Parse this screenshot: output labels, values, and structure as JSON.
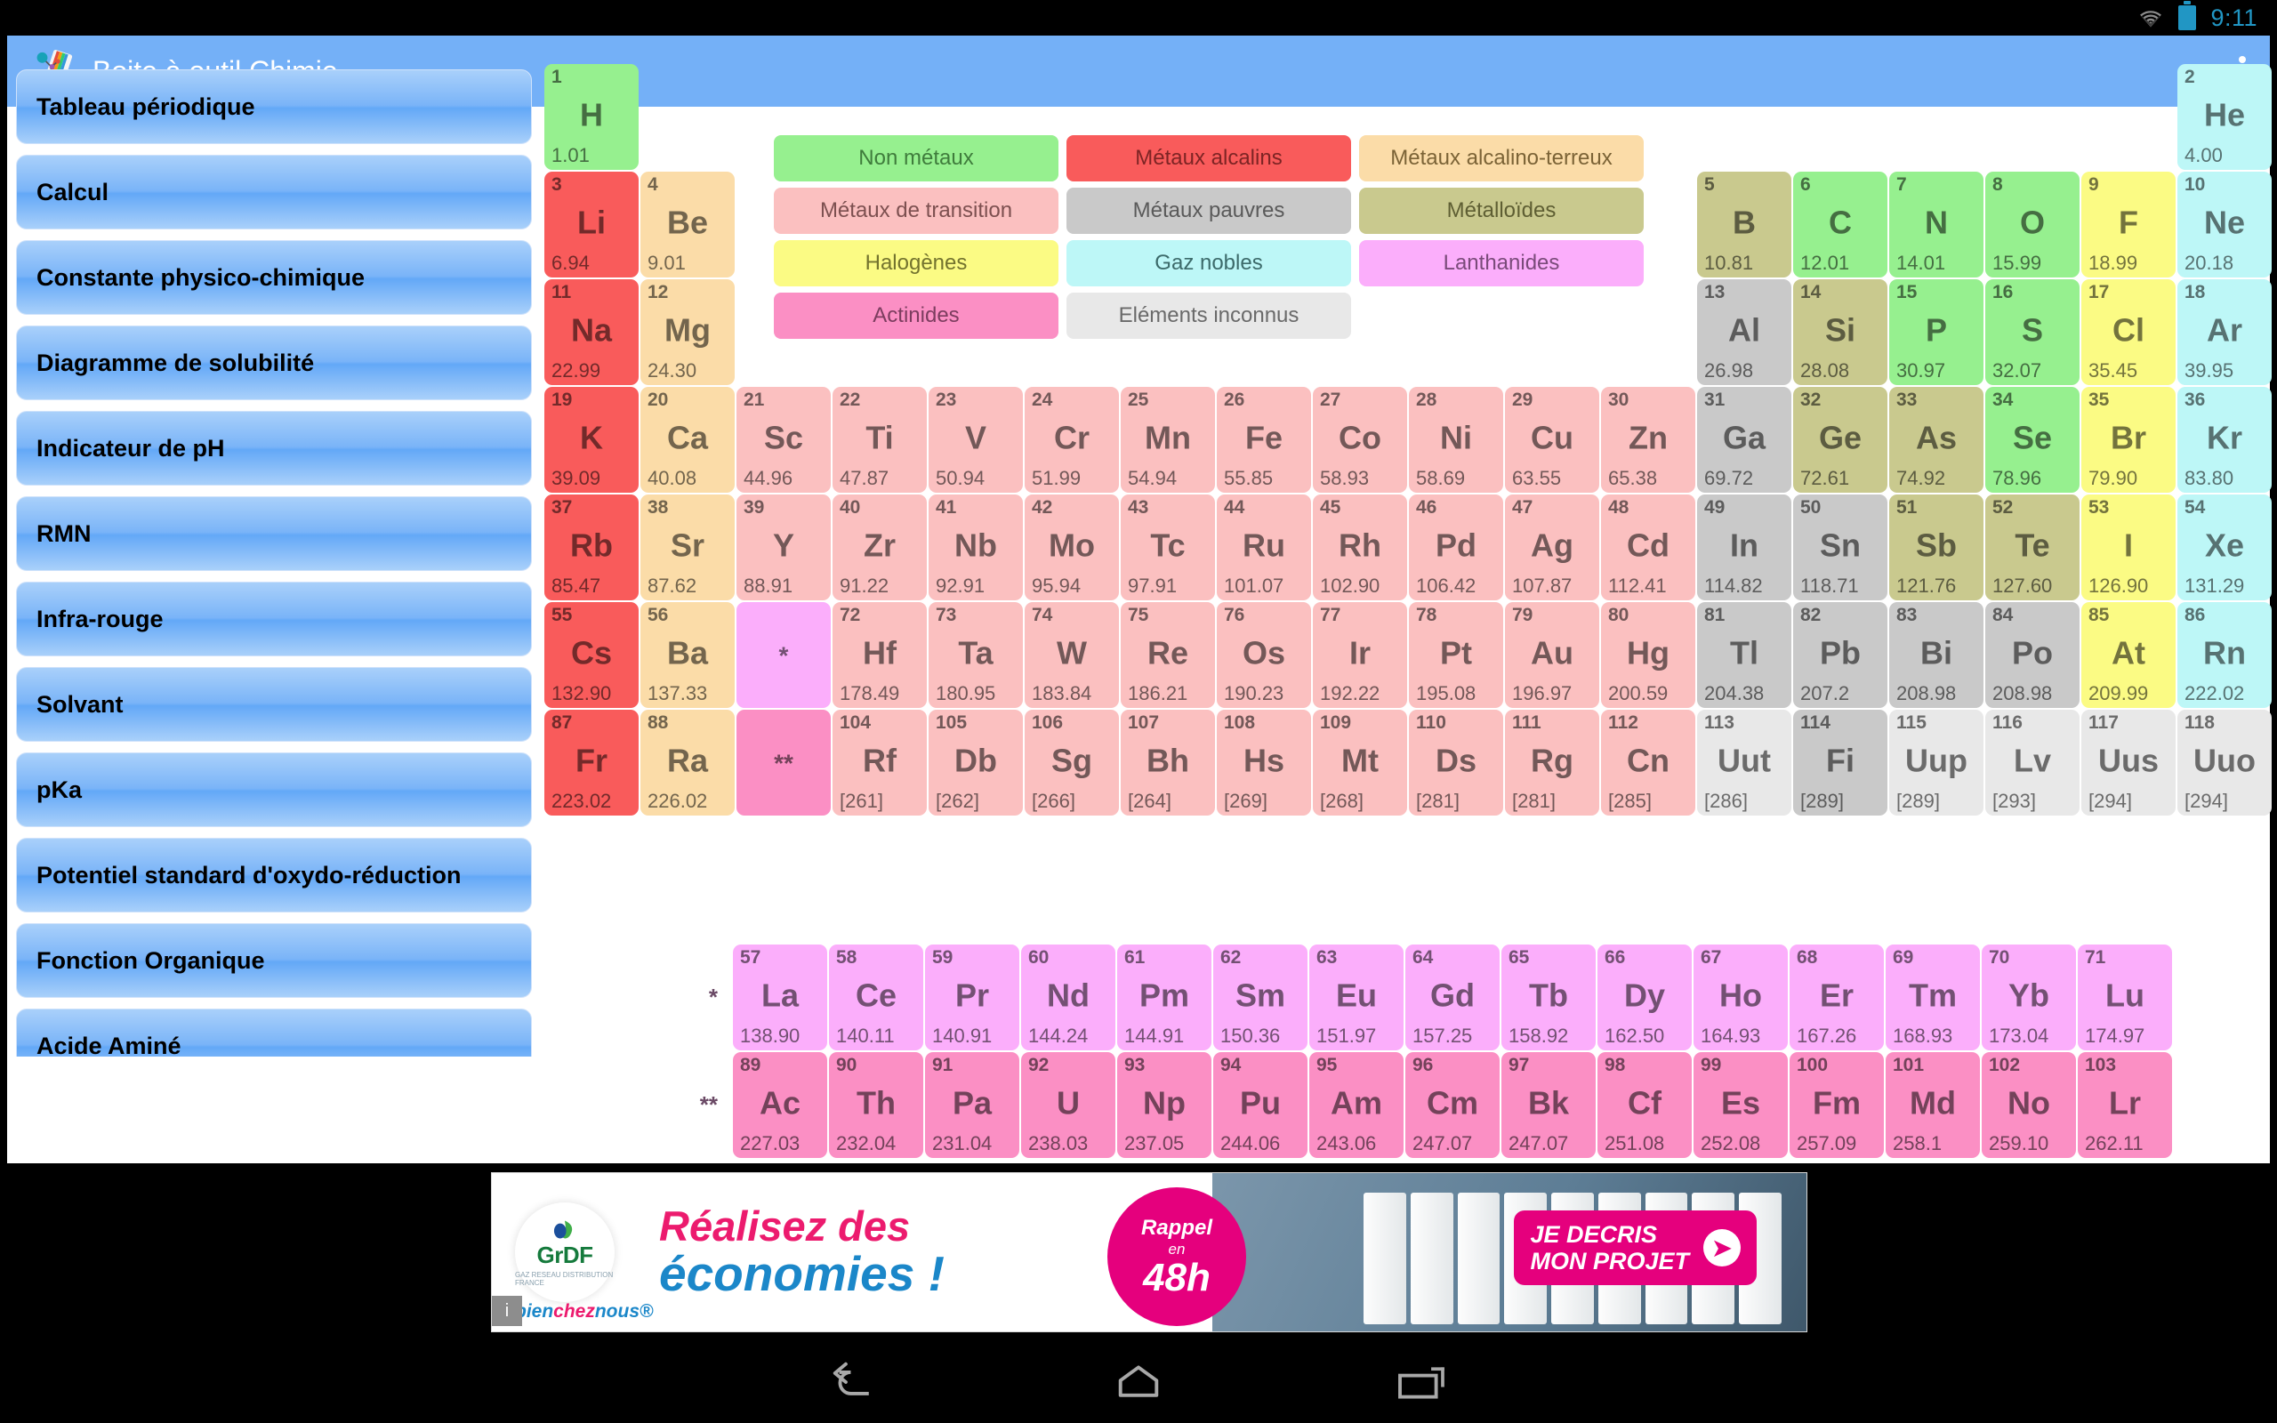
{
  "status_bar": {
    "time": "9:11",
    "wifi_icon": "wifi-icon",
    "battery_icon": "battery-icon"
  },
  "app_bar": {
    "title": "Boite à outil Chimie",
    "logo_icon": "chemistry-toolbox-icon",
    "overflow_icon": "overflow-menu-icon"
  },
  "sidebar": {
    "items": [
      {
        "label": "Tableau périodique"
      },
      {
        "label": "Calcul"
      },
      {
        "label": "Constante physico-chimique"
      },
      {
        "label": "Diagramme de solubilité"
      },
      {
        "label": "Indicateur de pH"
      },
      {
        "label": "RMN"
      },
      {
        "label": "Infra-rouge"
      },
      {
        "label": "Solvant"
      },
      {
        "label": "pKa"
      },
      {
        "label": "Potentiel standard d'oxydo-réduction"
      },
      {
        "label": "Fonction Organique"
      },
      {
        "label": "Acide Aminé"
      }
    ]
  },
  "legend": {
    "items": [
      {
        "label": "Non métaux",
        "color": "#96f08f",
        "text": "#3f7c3c"
      },
      {
        "label": "Métaux alcalins",
        "color": "#f95b5b",
        "text": "#7d2424"
      },
      {
        "label": "Métaux alcalino-terreux",
        "color": "#fbdca8",
        "text": "#7b6336"
      },
      {
        "label": "Métaux de transition",
        "color": "#fbc0c0",
        "text": "#7d5050"
      },
      {
        "label": "Métaux pauvres",
        "color": "#c9c9c9",
        "text": "#5a5a5a"
      },
      {
        "label": "Métalloïdes",
        "color": "#c9c98e",
        "text": "#5e5e33"
      },
      {
        "label": "Halogènes",
        "color": "#fbfb84",
        "text": "#73732e"
      },
      {
        "label": "Gaz nobles",
        "color": "#bdf7f7",
        "text": "#3c6a6a"
      },
      {
        "label": "Lanthanides",
        "color": "#fbaefb",
        "text": "#7a4b7a"
      },
      {
        "label": "Actinides",
        "color": "#fb8fc4",
        "text": "#7c3d5f"
      },
      {
        "label": "Eléments inconnus",
        "color": "#e8e8e8",
        "text": "#6a6a6a"
      }
    ]
  },
  "colors": {
    "nonmetal": "#96f08f",
    "alkali": "#f95b5b",
    "alkaline_earth": "#fbdca8",
    "transition": "#fbc0c0",
    "poor_metal": "#c9c9c9",
    "metalloid": "#c9c98e",
    "halogen": "#fbfb84",
    "noble_gas": "#bdf7f7",
    "lanthanide": "#fbaefb",
    "actinide": "#fb8fc4",
    "unknown": "#e8e8e8",
    "accent": "#74b0f7"
  },
  "periodic_table": {
    "main_rows": [
      [
        {
          "n": "1",
          "s": "H",
          "m": "1.01",
          "c": "nonmetal"
        },
        null,
        null,
        null,
        null,
        null,
        null,
        null,
        null,
        null,
        null,
        null,
        null,
        null,
        null,
        null,
        null,
        {
          "n": "2",
          "s": "He",
          "m": "4.00",
          "c": "noble_gas"
        }
      ],
      [
        {
          "n": "3",
          "s": "Li",
          "m": "6.94",
          "c": "alkali"
        },
        {
          "n": "4",
          "s": "Be",
          "m": "9.01",
          "c": "alkaline_earth"
        },
        null,
        null,
        null,
        null,
        null,
        null,
        null,
        null,
        null,
        null,
        {
          "n": "5",
          "s": "B",
          "m": "10.81",
          "c": "metalloid"
        },
        {
          "n": "6",
          "s": "C",
          "m": "12.01",
          "c": "nonmetal"
        },
        {
          "n": "7",
          "s": "N",
          "m": "14.01",
          "c": "nonmetal"
        },
        {
          "n": "8",
          "s": "O",
          "m": "15.99",
          "c": "nonmetal"
        },
        {
          "n": "9",
          "s": "F",
          "m": "18.99",
          "c": "halogen"
        },
        {
          "n": "10",
          "s": "Ne",
          "m": "20.18",
          "c": "noble_gas"
        }
      ],
      [
        {
          "n": "11",
          "s": "Na",
          "m": "22.99",
          "c": "alkali"
        },
        {
          "n": "12",
          "s": "Mg",
          "m": "24.30",
          "c": "alkaline_earth"
        },
        null,
        null,
        null,
        null,
        null,
        null,
        null,
        null,
        null,
        null,
        {
          "n": "13",
          "s": "Al",
          "m": "26.98",
          "c": "poor_metal"
        },
        {
          "n": "14",
          "s": "Si",
          "m": "28.08",
          "c": "metalloid"
        },
        {
          "n": "15",
          "s": "P",
          "m": "30.97",
          "c": "nonmetal"
        },
        {
          "n": "16",
          "s": "S",
          "m": "32.07",
          "c": "nonmetal"
        },
        {
          "n": "17",
          "s": "Cl",
          "m": "35.45",
          "c": "halogen"
        },
        {
          "n": "18",
          "s": "Ar",
          "m": "39.95",
          "c": "noble_gas"
        }
      ],
      [
        {
          "n": "19",
          "s": "K",
          "m": "39.09",
          "c": "alkali"
        },
        {
          "n": "20",
          "s": "Ca",
          "m": "40.08",
          "c": "alkaline_earth"
        },
        {
          "n": "21",
          "s": "Sc",
          "m": "44.96",
          "c": "transition"
        },
        {
          "n": "22",
          "s": "Ti",
          "m": "47.87",
          "c": "transition"
        },
        {
          "n": "23",
          "s": "V",
          "m": "50.94",
          "c": "transition"
        },
        {
          "n": "24",
          "s": "Cr",
          "m": "51.99",
          "c": "transition"
        },
        {
          "n": "25",
          "s": "Mn",
          "m": "54.94",
          "c": "transition"
        },
        {
          "n": "26",
          "s": "Fe",
          "m": "55.85",
          "c": "transition"
        },
        {
          "n": "27",
          "s": "Co",
          "m": "58.93",
          "c": "transition"
        },
        {
          "n": "28",
          "s": "Ni",
          "m": "58.69",
          "c": "transition"
        },
        {
          "n": "29",
          "s": "Cu",
          "m": "63.55",
          "c": "transition"
        },
        {
          "n": "30",
          "s": "Zn",
          "m": "65.38",
          "c": "transition"
        },
        {
          "n": "31",
          "s": "Ga",
          "m": "69.72",
          "c": "poor_metal"
        },
        {
          "n": "32",
          "s": "Ge",
          "m": "72.61",
          "c": "metalloid"
        },
        {
          "n": "33",
          "s": "As",
          "m": "74.92",
          "c": "metalloid"
        },
        {
          "n": "34",
          "s": "Se",
          "m": "78.96",
          "c": "nonmetal"
        },
        {
          "n": "35",
          "s": "Br",
          "m": "79.90",
          "c": "halogen"
        },
        {
          "n": "36",
          "s": "Kr",
          "m": "83.80",
          "c": "noble_gas"
        }
      ],
      [
        {
          "n": "37",
          "s": "Rb",
          "m": "85.47",
          "c": "alkali"
        },
        {
          "n": "38",
          "s": "Sr",
          "m": "87.62",
          "c": "alkaline_earth"
        },
        {
          "n": "39",
          "s": "Y",
          "m": "88.91",
          "c": "transition"
        },
        {
          "n": "40",
          "s": "Zr",
          "m": "91.22",
          "c": "transition"
        },
        {
          "n": "41",
          "s": "Nb",
          "m": "92.91",
          "c": "transition"
        },
        {
          "n": "42",
          "s": "Mo",
          "m": "95.94",
          "c": "transition"
        },
        {
          "n": "43",
          "s": "Tc",
          "m": "97.91",
          "c": "transition"
        },
        {
          "n": "44",
          "s": "Ru",
          "m": "101.07",
          "c": "transition"
        },
        {
          "n": "45",
          "s": "Rh",
          "m": "102.90",
          "c": "transition"
        },
        {
          "n": "46",
          "s": "Pd",
          "m": "106.42",
          "c": "transition"
        },
        {
          "n": "47",
          "s": "Ag",
          "m": "107.87",
          "c": "transition"
        },
        {
          "n": "48",
          "s": "Cd",
          "m": "112.41",
          "c": "transition"
        },
        {
          "n": "49",
          "s": "In",
          "m": "114.82",
          "c": "poor_metal"
        },
        {
          "n": "50",
          "s": "Sn",
          "m": "118.71",
          "c": "poor_metal"
        },
        {
          "n": "51",
          "s": "Sb",
          "m": "121.76",
          "c": "metalloid"
        },
        {
          "n": "52",
          "s": "Te",
          "m": "127.60",
          "c": "metalloid"
        },
        {
          "n": "53",
          "s": "I",
          "m": "126.90",
          "c": "halogen"
        },
        {
          "n": "54",
          "s": "Xe",
          "m": "131.29",
          "c": "noble_gas"
        }
      ],
      [
        {
          "n": "55",
          "s": "Cs",
          "m": "132.90",
          "c": "alkali"
        },
        {
          "n": "56",
          "s": "Ba",
          "m": "137.33",
          "c": "alkaline_earth"
        },
        {
          "n": "",
          "s": "*",
          "m": "",
          "c": "lanthanide",
          "placeholder": true
        },
        {
          "n": "72",
          "s": "Hf",
          "m": "178.49",
          "c": "transition"
        },
        {
          "n": "73",
          "s": "Ta",
          "m": "180.95",
          "c": "transition"
        },
        {
          "n": "74",
          "s": "W",
          "m": "183.84",
          "c": "transition"
        },
        {
          "n": "75",
          "s": "Re",
          "m": "186.21",
          "c": "transition"
        },
        {
          "n": "76",
          "s": "Os",
          "m": "190.23",
          "c": "transition"
        },
        {
          "n": "77",
          "s": "Ir",
          "m": "192.22",
          "c": "transition"
        },
        {
          "n": "78",
          "s": "Pt",
          "m": "195.08",
          "c": "transition"
        },
        {
          "n": "79",
          "s": "Au",
          "m": "196.97",
          "c": "transition"
        },
        {
          "n": "80",
          "s": "Hg",
          "m": "200.59",
          "c": "transition"
        },
        {
          "n": "81",
          "s": "Tl",
          "m": "204.38",
          "c": "poor_metal"
        },
        {
          "n": "82",
          "s": "Pb",
          "m": "207.2",
          "c": "poor_metal"
        },
        {
          "n": "83",
          "s": "Bi",
          "m": "208.98",
          "c": "poor_metal"
        },
        {
          "n": "84",
          "s": "Po",
          "m": "208.98",
          "c": "poor_metal"
        },
        {
          "n": "85",
          "s": "At",
          "m": "209.99",
          "c": "halogen"
        },
        {
          "n": "86",
          "s": "Rn",
          "m": "222.02",
          "c": "noble_gas"
        }
      ],
      [
        {
          "n": "87",
          "s": "Fr",
          "m": "223.02",
          "c": "alkali"
        },
        {
          "n": "88",
          "s": "Ra",
          "m": "226.02",
          "c": "alkaline_earth"
        },
        {
          "n": "",
          "s": "**",
          "m": "",
          "c": "actinide",
          "placeholder": true
        },
        {
          "n": "104",
          "s": "Rf",
          "m": "[261]",
          "c": "transition"
        },
        {
          "n": "105",
          "s": "Db",
          "m": "[262]",
          "c": "transition"
        },
        {
          "n": "106",
          "s": "Sg",
          "m": "[266]",
          "c": "transition"
        },
        {
          "n": "107",
          "s": "Bh",
          "m": "[264]",
          "c": "transition"
        },
        {
          "n": "108",
          "s": "Hs",
          "m": "[269]",
          "c": "transition"
        },
        {
          "n": "109",
          "s": "Mt",
          "m": "[268]",
          "c": "transition"
        },
        {
          "n": "110",
          "s": "Ds",
          "m": "[281]",
          "c": "transition"
        },
        {
          "n": "111",
          "s": "Rg",
          "m": "[281]",
          "c": "transition"
        },
        {
          "n": "112",
          "s": "Cn",
          "m": "[285]",
          "c": "transition"
        },
        {
          "n": "113",
          "s": "Uut",
          "m": "[286]",
          "c": "unknown"
        },
        {
          "n": "114",
          "s": "Fi",
          "m": "[289]",
          "c": "poor_metal"
        },
        {
          "n": "115",
          "s": "Uup",
          "m": "[289]",
          "c": "unknown"
        },
        {
          "n": "116",
          "s": "Lv",
          "m": "[293]",
          "c": "unknown"
        },
        {
          "n": "117",
          "s": "Uus",
          "m": "[294]",
          "c": "unknown"
        },
        {
          "n": "118",
          "s": "Uuo",
          "m": "[294]",
          "c": "unknown"
        }
      ]
    ],
    "lanthanide_marker": "*",
    "actinide_marker": "**",
    "lanthanides": [
      {
        "n": "57",
        "s": "La",
        "m": "138.90",
        "c": "lanthanide"
      },
      {
        "n": "58",
        "s": "Ce",
        "m": "140.11",
        "c": "lanthanide"
      },
      {
        "n": "59",
        "s": "Pr",
        "m": "140.91",
        "c": "lanthanide"
      },
      {
        "n": "60",
        "s": "Nd",
        "m": "144.24",
        "c": "lanthanide"
      },
      {
        "n": "61",
        "s": "Pm",
        "m": "144.91",
        "c": "lanthanide"
      },
      {
        "n": "62",
        "s": "Sm",
        "m": "150.36",
        "c": "lanthanide"
      },
      {
        "n": "63",
        "s": "Eu",
        "m": "151.97",
        "c": "lanthanide"
      },
      {
        "n": "64",
        "s": "Gd",
        "m": "157.25",
        "c": "lanthanide"
      },
      {
        "n": "65",
        "s": "Tb",
        "m": "158.92",
        "c": "lanthanide"
      },
      {
        "n": "66",
        "s": "Dy",
        "m": "162.50",
        "c": "lanthanide"
      },
      {
        "n": "67",
        "s": "Ho",
        "m": "164.93",
        "c": "lanthanide"
      },
      {
        "n": "68",
        "s": "Er",
        "m": "167.26",
        "c": "lanthanide"
      },
      {
        "n": "69",
        "s": "Tm",
        "m": "168.93",
        "c": "lanthanide"
      },
      {
        "n": "70",
        "s": "Yb",
        "m": "173.04",
        "c": "lanthanide"
      },
      {
        "n": "71",
        "s": "Lu",
        "m": "174.97",
        "c": "lanthanide"
      }
    ],
    "actinides": [
      {
        "n": "89",
        "s": "Ac",
        "m": "227.03",
        "c": "actinide"
      },
      {
        "n": "90",
        "s": "Th",
        "m": "232.04",
        "c": "actinide"
      },
      {
        "n": "91",
        "s": "Pa",
        "m": "231.04",
        "c": "actinide"
      },
      {
        "n": "92",
        "s": "U",
        "m": "238.03",
        "c": "actinide"
      },
      {
        "n": "93",
        "s": "Np",
        "m": "237.05",
        "c": "actinide"
      },
      {
        "n": "94",
        "s": "Pu",
        "m": "244.06",
        "c": "actinide"
      },
      {
        "n": "95",
        "s": "Am",
        "m": "243.06",
        "c": "actinide"
      },
      {
        "n": "96",
        "s": "Cm",
        "m": "247.07",
        "c": "actinide"
      },
      {
        "n": "97",
        "s": "Bk",
        "m": "247.07",
        "c": "actinide"
      },
      {
        "n": "98",
        "s": "Cf",
        "m": "251.08",
        "c": "actinide"
      },
      {
        "n": "99",
        "s": "Es",
        "m": "252.08",
        "c": "actinide"
      },
      {
        "n": "100",
        "s": "Fm",
        "m": "257.09",
        "c": "actinide"
      },
      {
        "n": "101",
        "s": "Md",
        "m": "258.1",
        "c": "actinide"
      },
      {
        "n": "102",
        "s": "No",
        "m": "259.10",
        "c": "actinide"
      },
      {
        "n": "103",
        "s": "Lr",
        "m": "262.11",
        "c": "actinide"
      }
    ]
  },
  "ad": {
    "logo_text": "GrDF",
    "logo_sub": "GAZ RESEAU DISTRIBUTION FRANCE",
    "headline_line1": "Réalisez des",
    "headline_line2": "économies !",
    "brand_part1": "bien",
    "brand_part2": "chez",
    "brand_part3": "nous®",
    "bubble_line1": "Rappel",
    "bubble_line2": "en",
    "bubble_line3": "48h",
    "cta_line1": "JE DECRIS",
    "cta_line2": "MON PROJET",
    "cta_arrow_icon": "arrow-right-icon",
    "info_icon": "info-icon"
  },
  "nav_bar": {
    "back_icon": "back-arrow-icon",
    "home_icon": "home-icon",
    "recents_icon": "recent-apps-icon"
  }
}
